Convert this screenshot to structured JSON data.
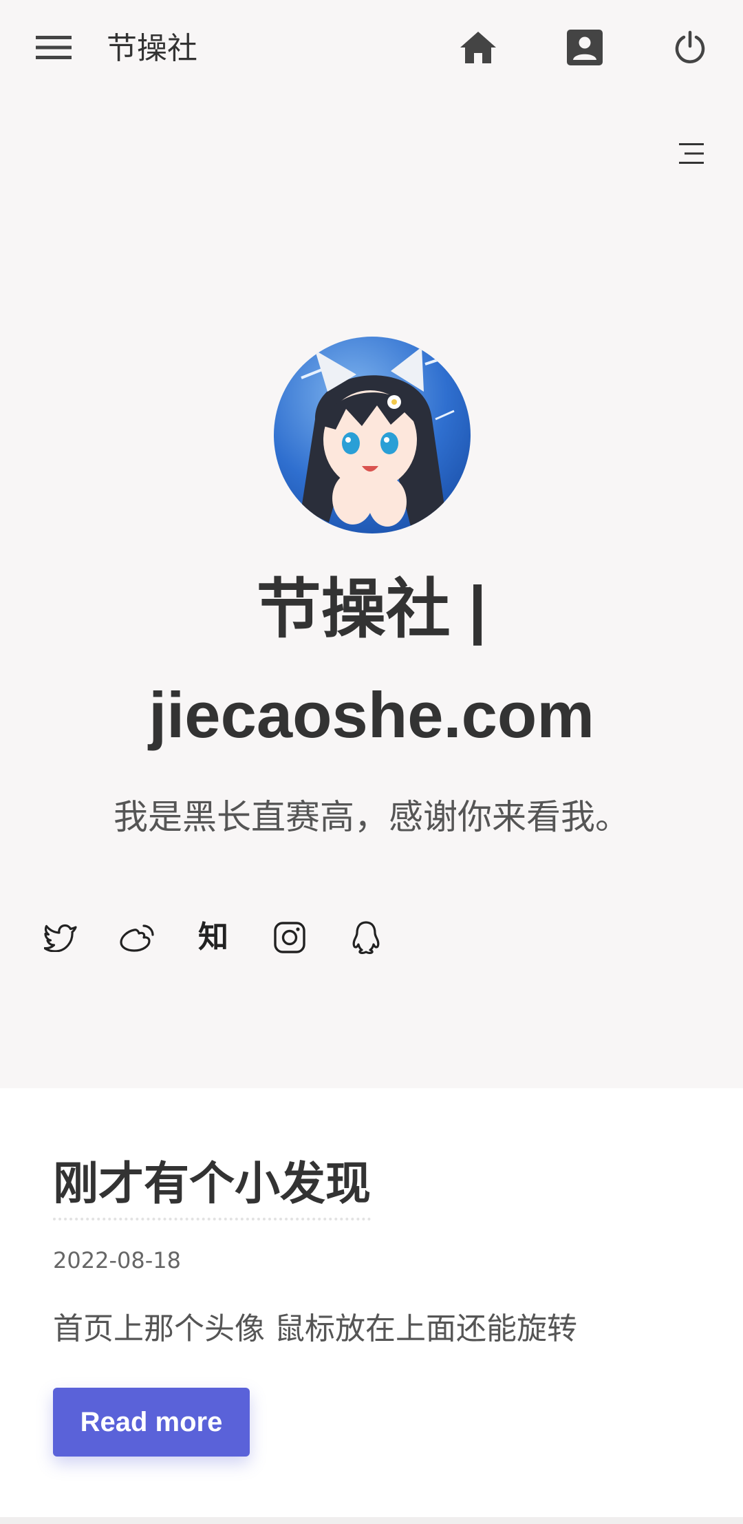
{
  "topbar": {
    "site_name": "节操社",
    "icons": [
      "menu-icon",
      "home-icon",
      "account-box-icon",
      "power-icon"
    ]
  },
  "toc": {
    "icon": "table-of-contents-icon"
  },
  "hero": {
    "title": "节操社 | jiecaoshe.com",
    "subtitle": "我是黑长直赛高，感谢你来看我。"
  },
  "social": {
    "icons": [
      "twitter-icon",
      "weibo-icon",
      "zhihu-icon",
      "instagram-icon",
      "qq-icon"
    ],
    "zhihu_glyph": "知"
  },
  "post": {
    "title": "刚才有个小发现",
    "date": "2022-08-18",
    "excerpt": "首页上那个头像 鼠标放在上面还能旋转",
    "read_more_label": "Read more"
  },
  "colors": {
    "accent": "#5a62d9",
    "background": "#f8f6f6",
    "card": "#ffffff",
    "text": "#333333"
  }
}
